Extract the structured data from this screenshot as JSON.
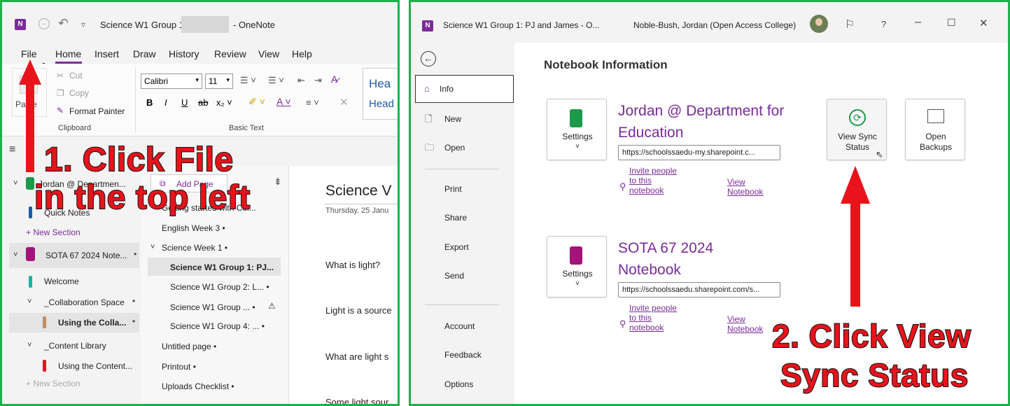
{
  "colors": {
    "frame": "#1fb04a",
    "onenote_purple": "#7a2b9a",
    "annotation": "#e8131b",
    "green_notebook": "#1a9a4a",
    "purple_notebook": "#a3137a"
  },
  "left": {
    "titlebar": {
      "title": "Science W1 Group 1:",
      "app": "- OneNote"
    },
    "menu": [
      "File",
      "Home",
      "Insert",
      "Draw",
      "History",
      "Review",
      "View",
      "Help"
    ],
    "clipboard": {
      "paste": "Paste",
      "cut": "Cut",
      "copy": "Copy",
      "format_painter": "Format Painter",
      "group_label": "Clipboard"
    },
    "basic_text": {
      "font": "Calibri",
      "size": "11",
      "group_label": "Basic Text"
    },
    "styles": {
      "heading1": "Hea",
      "heading2": "Head"
    },
    "notebooks": [
      {
        "label": "Jordan @ Departmen..."
      },
      {
        "label": "SOTA 67 2024 Note..."
      }
    ],
    "sections": [
      {
        "label": "Quick Notes"
      },
      {
        "label": "+  New Section"
      },
      {
        "label": "Welcome"
      },
      {
        "label": "_Collaboration Space"
      },
      {
        "label": "Using the Colla..."
      },
      {
        "label": "_Content Library"
      },
      {
        "label": "Using the Content..."
      },
      {
        "label": "+  New Section"
      }
    ],
    "add_page": "Add Page",
    "pages": [
      {
        "label": "Getting started with Col..."
      },
      {
        "label": "English Week 3 •"
      },
      {
        "label": "Science Week 1 •"
      },
      {
        "label": "Science W1 Group 1: PJ..."
      },
      {
        "label": "Science W1 Group 2: L... •"
      },
      {
        "label": "Science W1 Group ... •"
      },
      {
        "label": "Science W1 Group 4: ... •"
      },
      {
        "label": "Untitled page •"
      },
      {
        "label": "Printout •"
      },
      {
        "label": "Uploads Checklist •"
      }
    ],
    "page": {
      "title": "Science V",
      "date": "Thursday, 25 Janu",
      "lines": [
        "What is light?",
        "Light is a source",
        "What are light s",
        "Some light sour"
      ]
    },
    "annotation": {
      "line1": "1. Click File",
      "line2": "in the top left"
    }
  },
  "right": {
    "titlebar": {
      "title": "Science W1 Group 1: PJ and James  -  O...",
      "user": "Noble-Bush, Jordan (Open Access College)",
      "help": "?"
    },
    "nav": {
      "items": [
        "Info",
        "New",
        "Open",
        "Print",
        "Share",
        "Export",
        "Send",
        "Account",
        "Feedback",
        "Options"
      ]
    },
    "heading": "Notebook Information",
    "notebooks": [
      {
        "name": "Jordan @ Department for Education",
        "url": "https://schoolssaedu-my.sharepoint.c...",
        "settings": "Settings",
        "invite": "Invite people to this notebook",
        "view": "View Notebook"
      },
      {
        "name": "SOTA 67 2024 Notebook",
        "url": "https://schoolssaedu.sharepoint.com/s...",
        "settings": "Settings",
        "invite": "Invite people to this notebook",
        "view": "View Notebook"
      }
    ],
    "view_sync": "View Sync Status",
    "open_backups": "Open Backups",
    "annotation": {
      "line1": "2. Click View",
      "line2": "Sync Status"
    }
  }
}
